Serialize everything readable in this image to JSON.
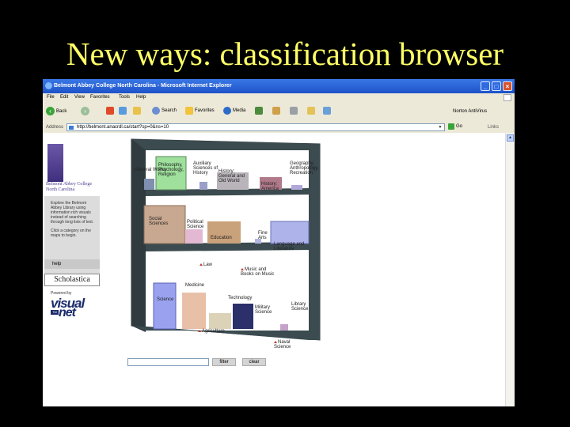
{
  "slide": {
    "title": "New ways:  classification browser"
  },
  "browser": {
    "window_title": "Belmont Abbey College North Carolina - Microsoft Internet Explorer",
    "menu": [
      "File",
      "Edit",
      "View",
      "Favorites",
      "Tools",
      "Help"
    ],
    "toolbar": {
      "back": "Back",
      "search": "Search",
      "favorites": "Favorites",
      "media": "Media",
      "norton": "Norton AntiVirus"
    },
    "address_label": "Address",
    "url": "http://belmont.anacrdl.ca/start?sp=0&ns=10",
    "go": "Go",
    "links": "Links"
  },
  "sidebar": {
    "college": "Belmont Abbey College North Carolina",
    "explore_text": "Explore the Belmont Abbey Library using information rich visuals instead of searching through long lists of text.",
    "click_text": "Click a category on the maps to begin.",
    "help": "help",
    "scholastica": "Scholastica",
    "powered_by": "Powered by",
    "visual": "visual",
    "net": "net"
  },
  "shelf": {
    "top": [
      "General Works",
      "Philosophy, Psychology, Religion",
      "Auxiliary Sciences of History",
      "History: General and Old World",
      "History: America",
      "Geography, Anthropology, Recreation"
    ],
    "middle": [
      "Social Sciences",
      "Political Science",
      "Education",
      "Fine Arts",
      "Language and Literature"
    ],
    "middle_below": [
      "Law"
    ],
    "bottom_above": [
      "Music and Books on Music"
    ],
    "bottom": [
      "Science",
      "Medicine",
      "Technology",
      "Military Science",
      "Library Science"
    ],
    "bottom_below": [
      "Agriculture",
      "Naval Science"
    ]
  },
  "controls": {
    "filter": "filter",
    "clear": "clear"
  },
  "colors": {
    "frame": "#3b4b4f",
    "titlebar": "#1d52c8",
    "slide_title": "#ffff66"
  }
}
